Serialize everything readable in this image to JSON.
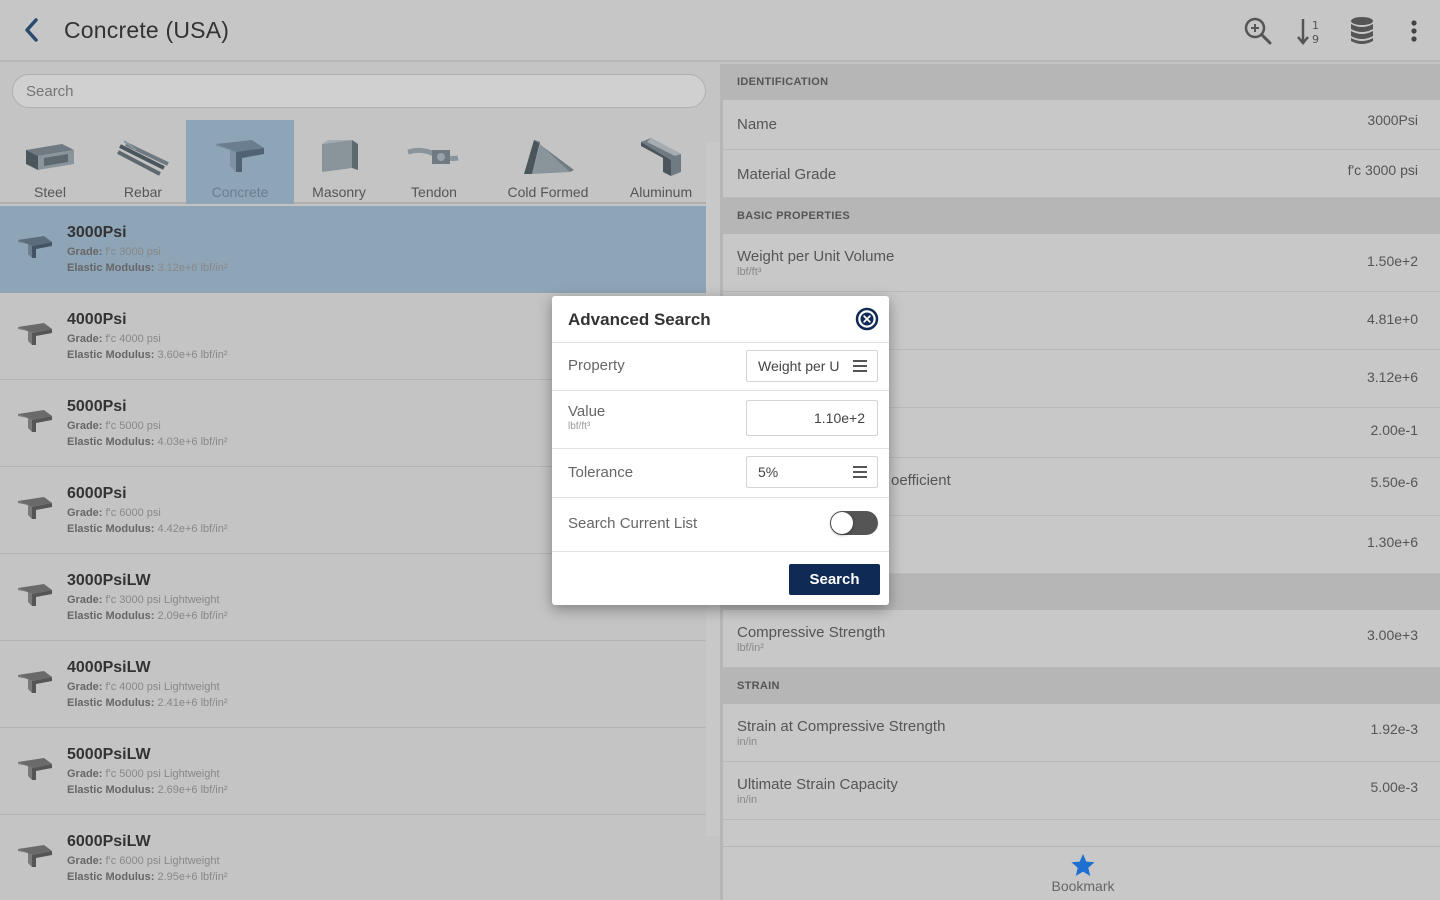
{
  "header": {
    "title": "Concrete (USA)"
  },
  "icons": {
    "back": "back-arrow-icon",
    "search": "zoom-search-icon",
    "sort": "sort-icon",
    "database": "database-icon",
    "more": "more-vertical-icon"
  },
  "search": {
    "placeholder": "Search"
  },
  "categories": [
    {
      "label": "Steel",
      "icon": "steel-beam-icon"
    },
    {
      "label": "Rebar",
      "icon": "rebar-icon"
    },
    {
      "label": "Concrete",
      "icon": "concrete-icon",
      "selected": true
    },
    {
      "label": "Masonry",
      "icon": "masonry-icon"
    },
    {
      "label": "Tendon",
      "icon": "tendon-icon"
    },
    {
      "label": "Cold Formed",
      "icon": "cold-formed-icon"
    },
    {
      "label": "Aluminum",
      "icon": "aluminum-icon"
    }
  ],
  "list": {
    "grade_label": "Grade:",
    "modulus_label": "Elastic Modulus:",
    "items": [
      {
        "name": "3000Psi",
        "grade": "f'c 3000 psi",
        "modulus": "3.12e+6 lbf/in²"
      },
      {
        "name": "4000Psi",
        "grade": "f'c 4000 psi",
        "modulus": "3.60e+6 lbf/in²"
      },
      {
        "name": "5000Psi",
        "grade": "f'c 5000 psi",
        "modulus": "4.03e+6 lbf/in²"
      },
      {
        "name": "6000Psi",
        "grade": "f'c 6000 psi",
        "modulus": "4.42e+6 lbf/in²"
      },
      {
        "name": "3000PsiLW",
        "grade": "f'c 3000 psi Lightweight",
        "modulus": "2.09e+6 lbf/in²"
      },
      {
        "name": "4000PsiLW",
        "grade": "f'c 4000 psi Lightweight",
        "modulus": "2.41e+6 lbf/in²"
      },
      {
        "name": "5000PsiLW",
        "grade": "f'c 5000 psi Lightweight",
        "modulus": "2.69e+6 lbf/in²"
      },
      {
        "name": "6000PsiLW",
        "grade": "f'c 6000 psi Lightweight",
        "modulus": "2.95e+6 lbf/in²"
      }
    ]
  },
  "details": {
    "identification": {
      "header": "IDENTIFICATION",
      "name_label": "Name",
      "name_value": "3000Psi",
      "grade_label": "Material Grade",
      "grade_value": "f'c 3000 psi"
    },
    "basic": {
      "header": "BASIC PROPERTIES",
      "rows": [
        {
          "label": "Weight per Unit Volume",
          "unit": "lbf/ft³",
          "value": "1.50e+2"
        },
        {
          "label": "",
          "unit": "",
          "value": "4.81e+0"
        },
        {
          "label": "",
          "unit": "",
          "value": "3.12e+6"
        },
        {
          "label": "",
          "unit": "",
          "value": "2.00e-1"
        },
        {
          "label": "oefficient",
          "unit": "",
          "value": "5.50e-6"
        },
        {
          "label": "",
          "unit": "",
          "value": "1.30e+6"
        }
      ]
    },
    "strength": {
      "header": "",
      "rows": [
        {
          "label": "Compressive Strength",
          "unit": "lbf/in²",
          "value": "3.00e+3"
        }
      ]
    },
    "strain": {
      "header": "STRAIN",
      "rows": [
        {
          "label": "Strain at Compressive Strength",
          "unit": "in/in",
          "value": "1.92e-3"
        },
        {
          "label": "Ultimate Strain Capacity",
          "unit": "in/in",
          "value": "5.00e-3"
        }
      ]
    }
  },
  "bottom": {
    "bookmark_label": "Bookmark",
    "icon": "star-icon"
  },
  "modal": {
    "title": "Advanced Search",
    "property_label": "Property",
    "property_value": "Weight per U",
    "value_label": "Value",
    "value_unit": "lbf/ft³",
    "value_value": "1.10e+2",
    "tolerance_label": "Tolerance",
    "tolerance_value": "5%",
    "current_list_label": "Search Current List",
    "current_list_on": false,
    "search_button": "Search"
  },
  "colors": {
    "accent": "#0f2a55",
    "selection": "#8ea4b7",
    "overlay_bg": "#c4c4c4",
    "star": "#1e6fd0"
  }
}
